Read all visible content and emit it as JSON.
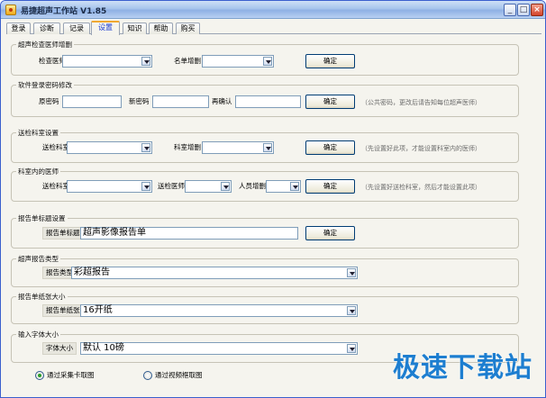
{
  "window": {
    "title": "易捷超声工作站 V1.85",
    "controls": {
      "minimize": "_",
      "maximize": "□",
      "close": "×"
    }
  },
  "tabs": [
    {
      "label": "登录",
      "active": false
    },
    {
      "label": "诊断",
      "active": false
    },
    {
      "label": "记录",
      "active": false
    },
    {
      "label": "设置",
      "active": true
    },
    {
      "label": "知识",
      "active": false
    },
    {
      "label": "帮助",
      "active": false
    },
    {
      "label": "购买",
      "active": false
    }
  ],
  "sections": {
    "doctor_add": {
      "title": "超声检查医师增删",
      "doctor_label": "检查医师",
      "list_label": "名单增删",
      "confirm": "确定"
    },
    "password": {
      "title": "软件登录密码修改",
      "old_label": "原密码",
      "new_label": "新密码",
      "repeat_label": "再确认",
      "confirm": "确定",
      "hint": "（公共密码，更改后请告知每位超声医师）"
    },
    "dept": {
      "title": "送检科室设置",
      "dept_label": "送检科室",
      "dept_edit_label": "科室增删",
      "confirm": "确定",
      "hint": "（先设置好此项，才能设置科室内的医师）"
    },
    "dept_doctor": {
      "title": "科室内的医师",
      "dept_label": "送检科室",
      "doctor_label": "送检医师",
      "staff_label": "人员增删",
      "confirm": "确定",
      "hint": "（先设置好送检科室，然后才能设置此项）"
    },
    "report_title": {
      "title": "报告单标题设置",
      "label": "报告单标题",
      "value": "超声影像报告单",
      "confirm": "确定"
    },
    "report_type": {
      "title": "超声报告类型",
      "label": "报告类型",
      "value": "彩超报告"
    },
    "paper": {
      "title": "报告单纸张大小",
      "label": "报告单纸张",
      "value": "16开纸"
    },
    "font": {
      "title": "输入字体大小",
      "label": "字体大小",
      "value": "默认 10磅"
    }
  },
  "capture": {
    "option1": "通过采集卡取图",
    "option2": "通过视频框取图",
    "selected": "option1"
  },
  "watermark": "极速下载站"
}
